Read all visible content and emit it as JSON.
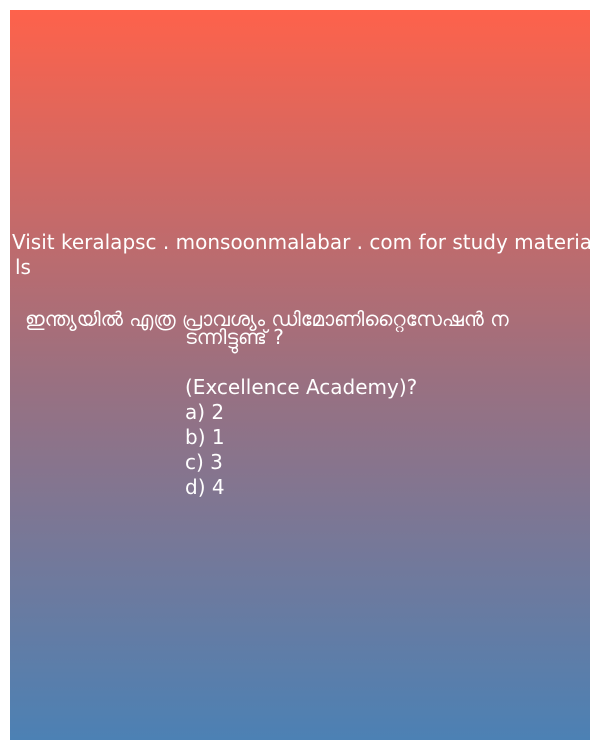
{
  "banner": {
    "line1": "Visit keralapsc . monsoonmalabar . com for study materia",
    "line2": "ls"
  },
  "question": {
    "line1": "ഇന്ത്യയിൽ എത്ര പ്രാവശ്യം ഡിമോണിറ്റൈസേഷൻ ന",
    "line2": "ടന്നിട്ടുണ്ട് ?"
  },
  "source": "(Excellence Academy)?",
  "options": [
    "a) 2",
    "b) 1",
    "c) 3",
    "d) 4"
  ]
}
